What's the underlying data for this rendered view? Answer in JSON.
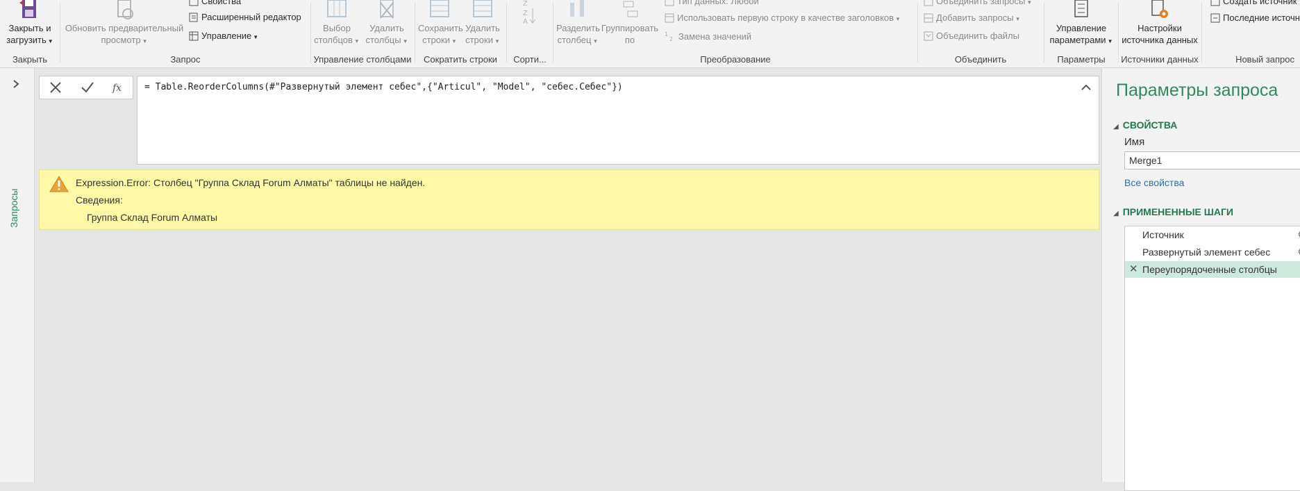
{
  "ribbon": {
    "groups": {
      "close": "Закрыть",
      "query": "Запрос",
      "manage_columns": "Управление столбцами",
      "reduce_rows": "Сократить строки",
      "sort": "Сорти...",
      "transform": "Преобразование",
      "combine": "Объединить",
      "parameters": "Параметры",
      "data_sources": "Источники данных",
      "new_query": "Новый запрос"
    },
    "close_load": [
      "Закрыть и",
      "загрузить"
    ],
    "refresh_preview": [
      "Обновить предварительный",
      "просмотр"
    ],
    "properties": "Свойства",
    "advanced_editor": "Расширенный редактор",
    "manage": "Управление",
    "choose_columns": [
      "Выбор",
      "столбцов"
    ],
    "remove_columns": [
      "Удалить",
      "столбцы"
    ],
    "keep_rows": [
      "Сохранить",
      "строки"
    ],
    "remove_rows": [
      "Удалить",
      "строки"
    ],
    "split_column": [
      "Разделить",
      "столбец"
    ],
    "group_by": [
      "Группировать",
      "по"
    ],
    "data_type": "Тип данных: Любой",
    "use_first_row": "Использовать первую строку в качестве заголовков",
    "replace_values": "Замена значений",
    "merge_queries": "Объединить запросы",
    "append_queries": "Добавить запросы",
    "combine_files": "Объединить файлы",
    "manage_parameters": [
      "Управление",
      "параметрами"
    ],
    "data_source_settings": [
      "Настройки",
      "источника данных"
    ],
    "create_source": "Создать источник",
    "recent_sources": "Последние источники"
  },
  "left_pane": {
    "label": "Запросы"
  },
  "formula": {
    "text": "= Table.ReorderColumns(#\"Развернутый элемент себес\",{\"Articul\", \"Model\", \"себес.Себес\"})"
  },
  "error": {
    "message": "Expression.Error: Столбец \"Группа Склад Forum Алматы\" таблицы не найден.",
    "details_label": "Сведения:",
    "detail": "Группа Склад Forum Алматы"
  },
  "settings": {
    "title": "Параметры запроса",
    "properties_header": "СВОЙСТВА",
    "name_label": "Имя",
    "name_value": "Merge1",
    "all_properties": "Все свойства",
    "applied_steps_header": "ПРИМЕНЕННЫЕ ШАГИ",
    "steps": [
      "Источник",
      "Развернутый элемент себес",
      "Переупорядоченные столбцы"
    ]
  },
  "colors": {
    "accent_green": "#2f8a5c",
    "error_bg": "#fff9a8",
    "link": "#2a6fb7"
  }
}
